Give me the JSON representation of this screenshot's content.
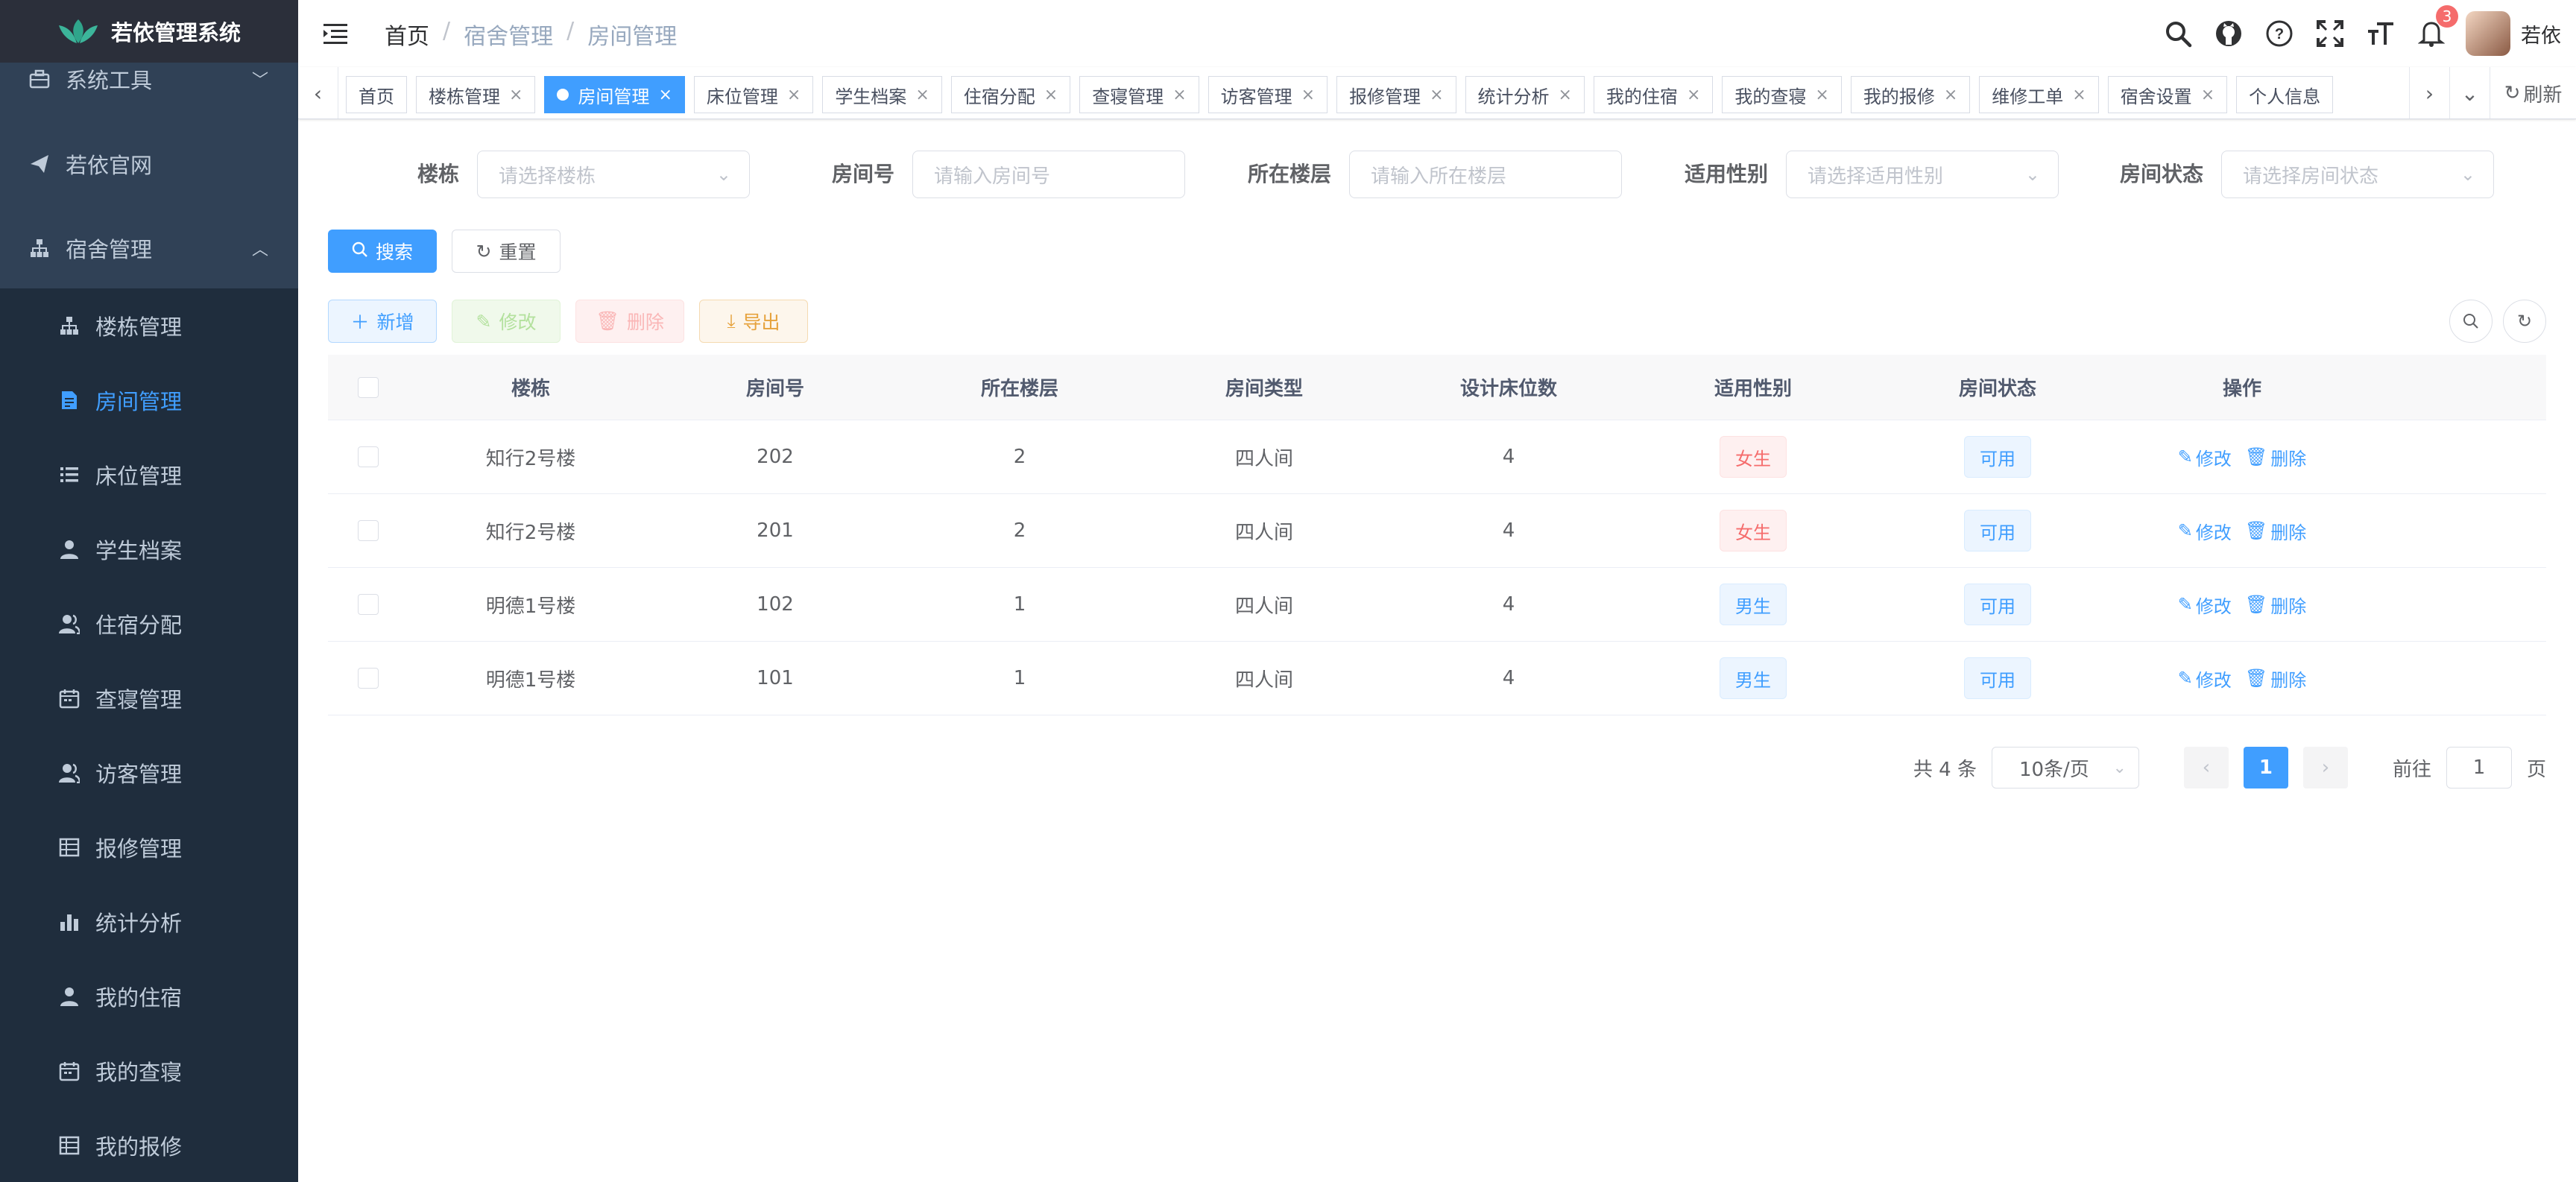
{
  "app": {
    "title": "若依管理系统",
    "user": "若依",
    "notification_count": "3",
    "accent": "#409eff",
    "sidebar_bg": "#304156"
  },
  "sidebar": {
    "top_items": [
      {
        "label": "系统工具",
        "icon": "toolbox-icon"
      },
      {
        "label": "若依官网",
        "icon": "send-icon"
      },
      {
        "label": "宿舍管理",
        "icon": "tree-icon"
      }
    ],
    "sub_items": [
      {
        "label": "楼栋管理",
        "icon": "tree-icon"
      },
      {
        "label": "房间管理",
        "icon": "document-icon",
        "active": true
      },
      {
        "label": "床位管理",
        "icon": "list-icon"
      },
      {
        "label": "学生档案",
        "icon": "user-icon"
      },
      {
        "label": "住宿分配",
        "icon": "peoples-icon"
      },
      {
        "label": "查寝管理",
        "icon": "calendar-icon"
      },
      {
        "label": "访客管理",
        "icon": "peoples-icon"
      },
      {
        "label": "报修管理",
        "icon": "table-icon"
      },
      {
        "label": "统计分析",
        "icon": "chart-icon"
      },
      {
        "label": "我的住宿",
        "icon": "user-icon"
      },
      {
        "label": "我的查寝",
        "icon": "calendar-icon"
      },
      {
        "label": "我的报修",
        "icon": "table-icon"
      }
    ]
  },
  "breadcrumb": [
    "首页",
    "宿舍管理",
    "房间管理"
  ],
  "tags": [
    {
      "label": "首页",
      "closable": false
    },
    {
      "label": "楼栋管理",
      "closable": true
    },
    {
      "label": "房间管理",
      "closable": true,
      "active": true
    },
    {
      "label": "床位管理",
      "closable": true
    },
    {
      "label": "学生档案",
      "closable": true
    },
    {
      "label": "住宿分配",
      "closable": true
    },
    {
      "label": "查寝管理",
      "closable": true
    },
    {
      "label": "访客管理",
      "closable": true
    },
    {
      "label": "报修管理",
      "closable": true
    },
    {
      "label": "统计分析",
      "closable": true
    },
    {
      "label": "我的住宿",
      "closable": true
    },
    {
      "label": "我的查寝",
      "closable": true
    },
    {
      "label": "我的报修",
      "closable": true
    },
    {
      "label": "维修工单",
      "closable": true
    },
    {
      "label": "宿舍设置",
      "closable": true
    },
    {
      "label": "个人信息",
      "closable": false
    }
  ],
  "tags_refresh": "刷新",
  "search_form": {
    "building": {
      "label": "楼栋",
      "placeholder": "请选择楼栋"
    },
    "room_no": {
      "label": "房间号",
      "placeholder": "请输入房间号"
    },
    "floor": {
      "label": "所在楼层",
      "placeholder": "请输入所在楼层"
    },
    "gender": {
      "label": "适用性别",
      "placeholder": "请选择适用性别"
    },
    "status": {
      "label": "房间状态",
      "placeholder": "请选择房间状态"
    },
    "search_btn": "搜索",
    "reset_btn": "重置"
  },
  "toolbar": {
    "add": "新增",
    "edit": "修改",
    "delete": "删除",
    "export": "导出"
  },
  "table": {
    "headers": [
      "楼栋",
      "房间号",
      "所在楼层",
      "房间类型",
      "设计床位数",
      "适用性别",
      "房间状态",
      "操作"
    ],
    "rows": [
      {
        "building": "知行2号楼",
        "room": "202",
        "floor": "2",
        "type": "四人间",
        "beds": "4",
        "gender": "女生",
        "status": "可用"
      },
      {
        "building": "知行2号楼",
        "room": "201",
        "floor": "2",
        "type": "四人间",
        "beds": "4",
        "gender": "女生",
        "status": "可用"
      },
      {
        "building": "明德1号楼",
        "room": "102",
        "floor": "1",
        "type": "四人间",
        "beds": "4",
        "gender": "男生",
        "status": "可用"
      },
      {
        "building": "明德1号楼",
        "room": "101",
        "floor": "1",
        "type": "四人间",
        "beds": "4",
        "gender": "男生",
        "status": "可用"
      }
    ],
    "op_edit": "修改",
    "op_delete": "删除"
  },
  "pagination": {
    "total": "共 4 条",
    "page_size": "10条/页",
    "current": "1",
    "goto_prefix": "前往",
    "goto_value": "1",
    "goto_suffix": "页"
  }
}
